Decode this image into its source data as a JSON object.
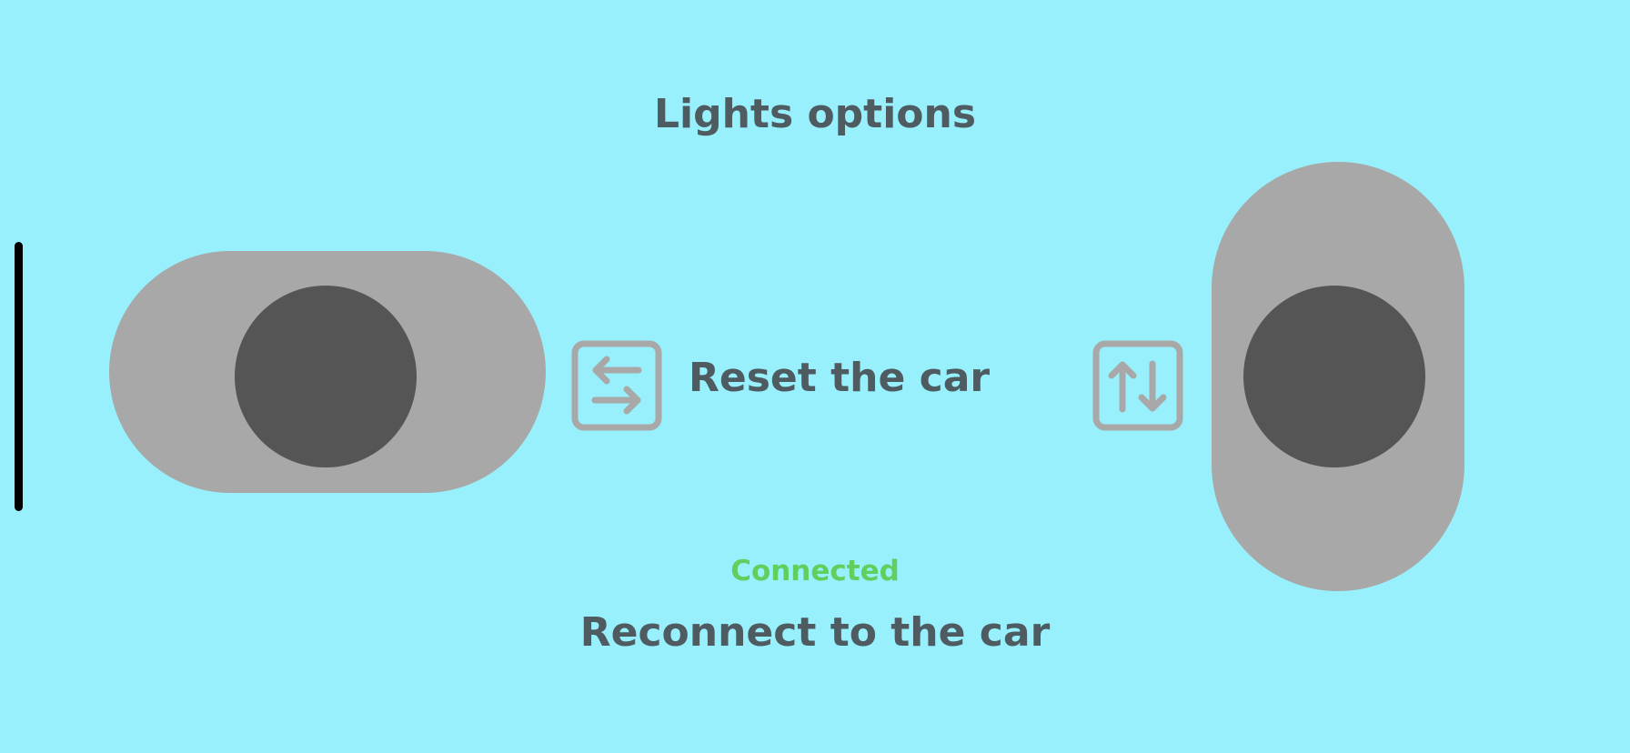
{
  "header": {
    "title": "Lights options"
  },
  "controls": {
    "left_joystick_icon": "joystick-knob-icon",
    "right_joystick_icon": "joystick-knob-icon",
    "horizontal_mode_icon": "arrows-left-right-icon",
    "vertical_mode_icon": "arrows-up-down-icon",
    "reset_label": "Reset the car"
  },
  "connection": {
    "status": "Connected",
    "status_color": "#5FCF5E",
    "reconnect_label": "Reconnect to the car"
  },
  "colors": {
    "background": "#98F0FD",
    "joystick_base": "#A8A8A8",
    "joystick_knob": "#555555",
    "text": "#4E5C61"
  }
}
